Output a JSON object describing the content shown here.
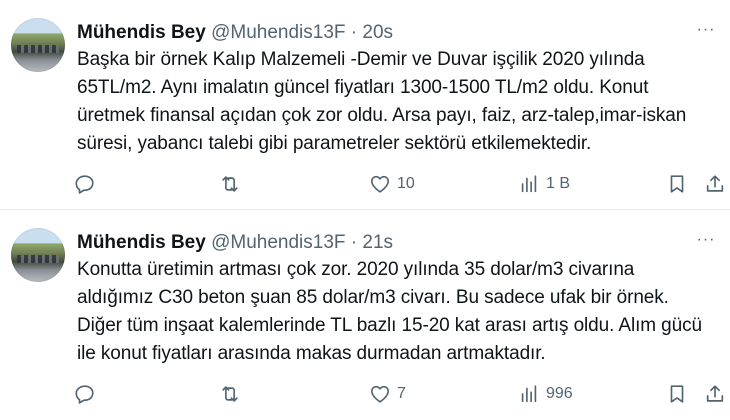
{
  "tweets": [
    {
      "author_name": "Mühendis Bey",
      "handle": "@Muhendis13F",
      "separator": "·",
      "time": "20s",
      "text_lines": [
        "Başka bir örnek Kalıp Malzemeli -Demir ve Duvar işçilik 2020 yılında",
        "65TL/m2. Aynı imalatın güncel fiyatları 1300-1500 TL/m2 oldu. Konut",
        "üretmek finansal açıdan çok zor oldu. Arsa payı, faiz, arz-talep,imar-iskan",
        "süresi, yabancı talebi gibi parametreler sektörü etkilemektedir."
      ],
      "reply_count": "",
      "retweet_count": "",
      "like_count": "10",
      "view_count": "1 B",
      "more_label": "···",
      "icons": [
        "reply-icon",
        "retweet-icon",
        "like-icon",
        "views-icon",
        "bookmark-icon",
        "share-icon"
      ]
    },
    {
      "author_name": "Mühendis Bey",
      "handle": "@Muhendis13F",
      "separator": "·",
      "time": "21s",
      "text_lines": [
        "Konutta üretimin artması çok zor. 2020 yılında 35 dolar/m3 civarına",
        "aldığımız C30 beton şuan 85 dolar/m3 civarı. Bu sadece ufak bir örnek.",
        "Diğer tüm inşaat kalemlerinde TL bazlı 15-20 kat arası artış oldu. Alım gücü",
        "ile konut fiyatları arasında makas durmadan artmaktadır."
      ],
      "reply_count": "",
      "retweet_count": "",
      "like_count": "7",
      "view_count": "996",
      "more_label": "···",
      "icons": [
        "reply-icon",
        "retweet-icon",
        "like-icon",
        "views-icon",
        "bookmark-icon",
        "share-icon"
      ]
    }
  ],
  "colors": {
    "text": "#0f1419",
    "muted": "#536471",
    "divider": "#e6e9ec",
    "background": "#ffffff"
  }
}
